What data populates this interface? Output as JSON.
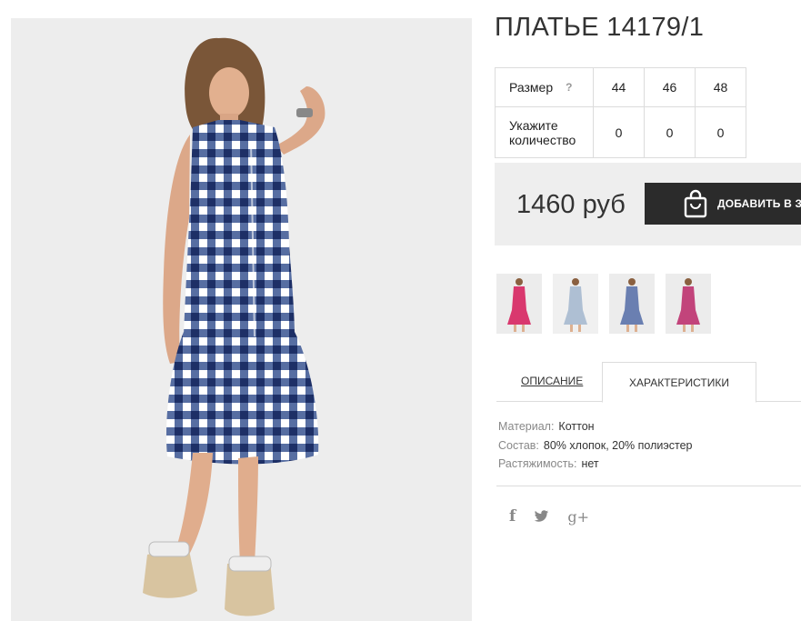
{
  "product": {
    "title": "ПЛАТЬЕ 14179/1",
    "photo_alt": "dress-photo"
  },
  "sizes": {
    "size_label": "Размер",
    "help": "?",
    "values": [
      "44",
      "46",
      "48"
    ],
    "qty_label": "Укажите количество",
    "quantities": [
      "0",
      "0",
      "0"
    ]
  },
  "price": {
    "amount": "1460 руб",
    "add_button": "ДОБАВИТЬ В З"
  },
  "thumbnails": [
    {
      "color": "#d9386e"
    },
    {
      "color": "#aebfd3"
    },
    {
      "color": "#6a7fb1"
    },
    {
      "color": "#c2447b"
    }
  ],
  "tabs": {
    "description": "ОПИСАНИЕ",
    "characteristics": "ХАРАКТЕРИСТИКИ"
  },
  "properties": [
    {
      "key": "Материал:",
      "value": "Коттон"
    },
    {
      "key": "Состав:",
      "value": "80% хлопок, 20% полиэстер"
    },
    {
      "key": "Растяжимость:",
      "value": "нет"
    }
  ],
  "social": {
    "facebook": "f",
    "twitter": "twitter-icon",
    "googleplus": "g+"
  },
  "colors": {
    "dark_button": "#2b2b2b",
    "price_bg": "#eeeeee",
    "dress_navy": "#243a73"
  }
}
